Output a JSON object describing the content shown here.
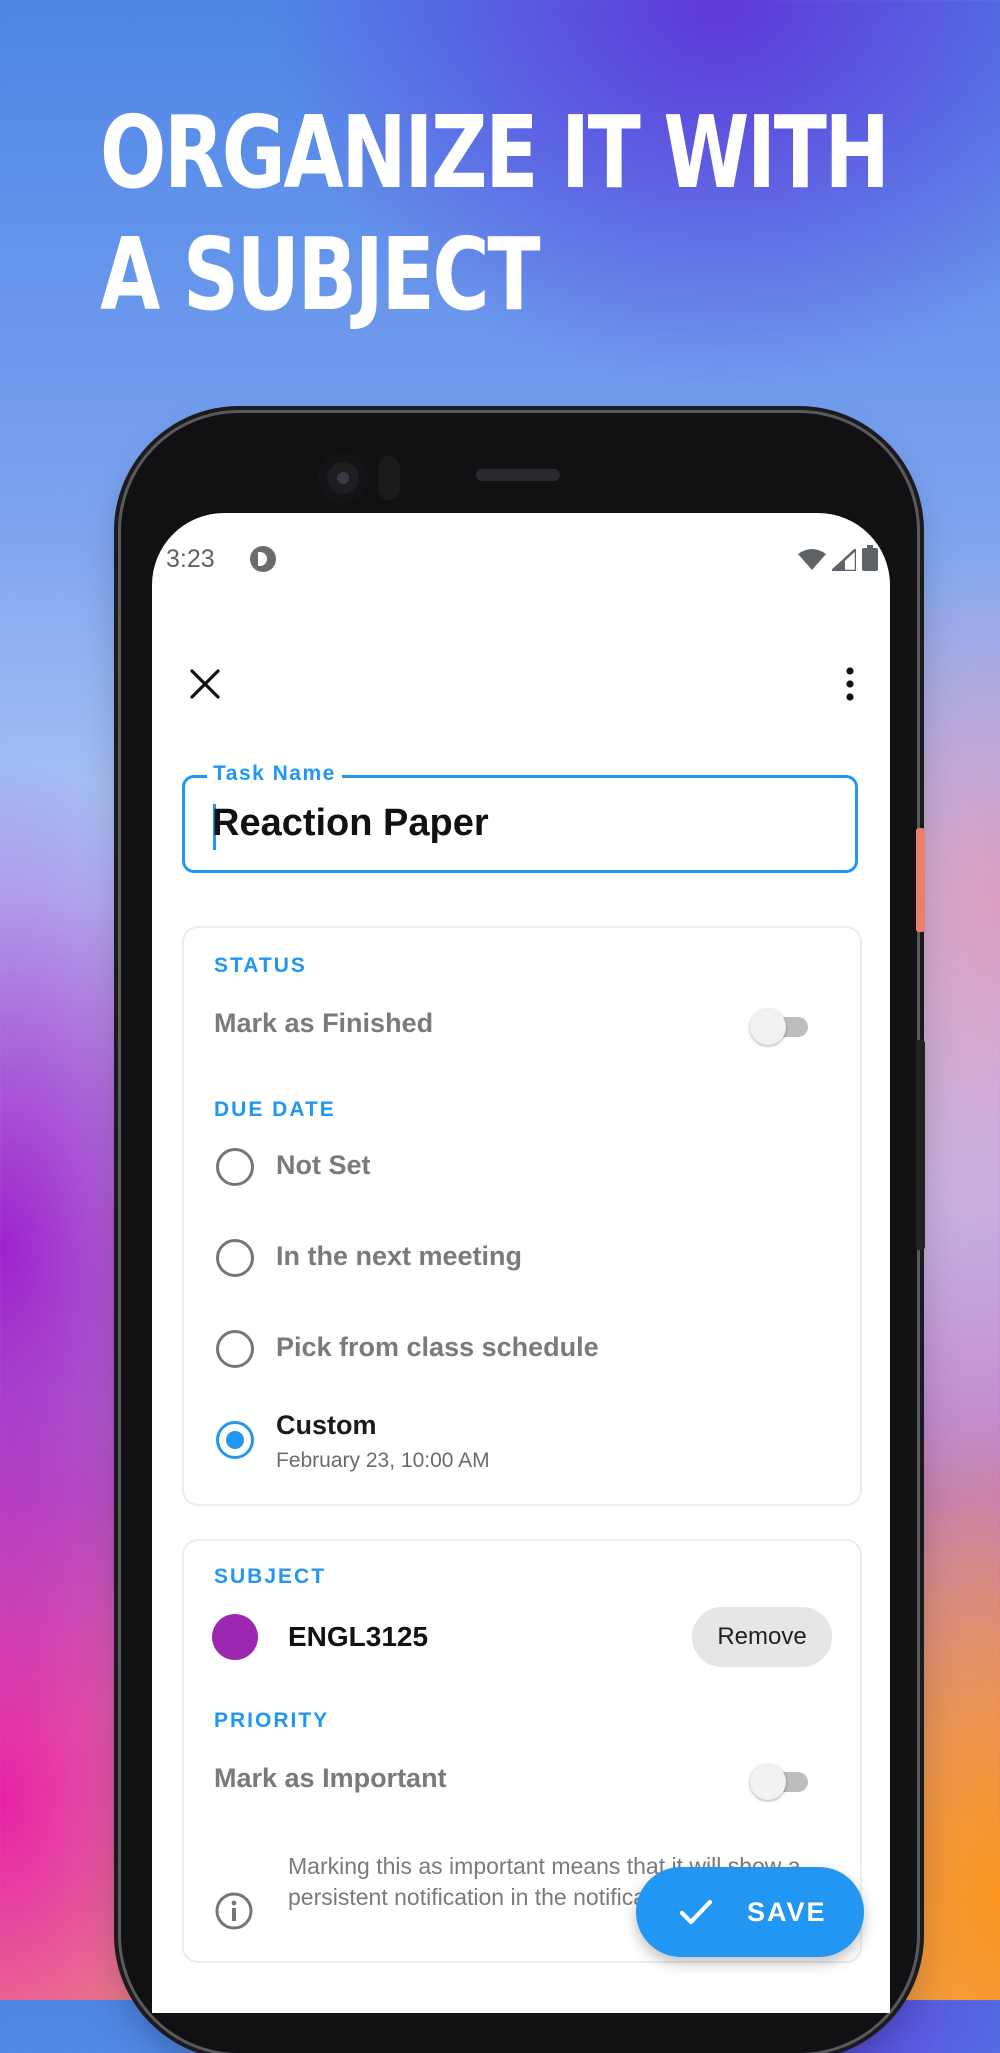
{
  "headline": {
    "line1": "ORGANIZE IT WITH",
    "line2": "A SUBJECT"
  },
  "status_bar": {
    "time": "3:23"
  },
  "form": {
    "task_name": {
      "label": "Task Name",
      "value": "Reaction Paper"
    },
    "status": {
      "section": "STATUS",
      "toggle_label": "Mark as Finished",
      "toggle_on": false
    },
    "due_date": {
      "section": "DUE DATE",
      "options": [
        {
          "label": "Not Set",
          "selected": false
        },
        {
          "label": "In the next meeting",
          "selected": false
        },
        {
          "label": "Pick from class schedule",
          "selected": false
        },
        {
          "label": "Custom",
          "selected": true,
          "sublabel": "February 23, 10:00 AM"
        }
      ]
    },
    "subject": {
      "section": "SUBJECT",
      "code": "ENGL3125",
      "color": "#9c27b0",
      "remove_label": "Remove"
    },
    "priority": {
      "section": "PRIORITY",
      "toggle_label": "Mark as Important",
      "toggle_on": false,
      "info": "Marking this as important means that it will show a persistent notification in the notification shade."
    }
  },
  "fab": {
    "label": "SAVE"
  },
  "colors": {
    "accent": "#2196f3",
    "subject": "#9c27b0"
  }
}
